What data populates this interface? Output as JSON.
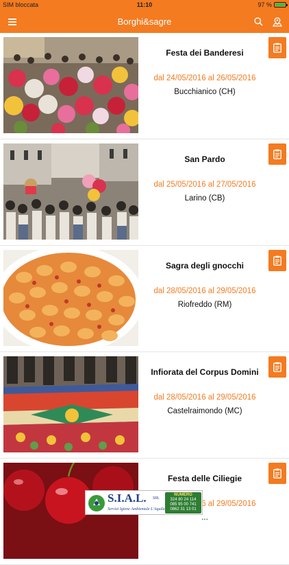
{
  "status": {
    "carrier": "SIM bloccata",
    "time": "11:10",
    "battery": "97 %"
  },
  "nav": {
    "title": "Borghi&sagre"
  },
  "colors": {
    "accent": "#f47b20"
  },
  "events": [
    {
      "name": "Festa dei Banderesi",
      "dates": "dal 24/05/2016 al 26/05/2016",
      "town": "Bucchianico (CH)"
    },
    {
      "name": "San Pardo",
      "dates": "dal 25/05/2016 al 27/05/2016",
      "town": "Larino (CB)"
    },
    {
      "name": "Sagra degli gnocchi",
      "dates": "dal 28/05/2016 al 29/05/2016",
      "town": "Riofreddo (RM)"
    },
    {
      "name": "Infiorata del Corpus Domini",
      "dates": "dal 28/05/2016 al 29/05/2016",
      "town": "Castelraimondo (MC)"
    },
    {
      "name": "Festa delle Ciliegie",
      "dates": "dal 28/05/2016 al 29/05/2016",
      "town": "..."
    }
  ],
  "ad": {
    "brand": "S.I.A.L.",
    "suffix": "SRL",
    "tagline": "Servizi Igiene Ambientale L'Aquila",
    "phone_label": "NUMERO",
    "phones": [
      "324 80 24 114",
      "085 95 00 741",
      "0862 31 13 01"
    ]
  }
}
